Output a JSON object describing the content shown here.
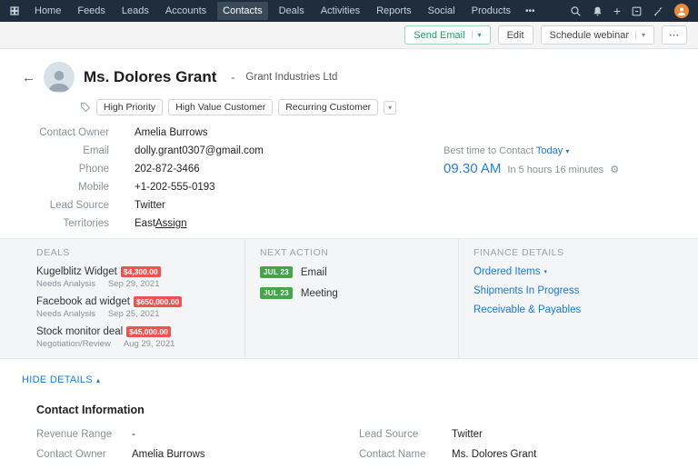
{
  "topnav": {
    "items": [
      "Home",
      "Feeds",
      "Leads",
      "Accounts",
      "Contacts",
      "Deals",
      "Activities",
      "Reports",
      "Social",
      "Products"
    ],
    "more": "•••"
  },
  "icons": {
    "plus": "+",
    "more": "•••",
    "ellipsis": "⋯",
    "caret_down": "▾",
    "caret_up": "▴",
    "back_arrow": "←",
    "gear": "⚙"
  },
  "actionbar": {
    "send_email": "Send Email",
    "edit": "Edit",
    "schedule_webinar": "Schedule webinar"
  },
  "contact": {
    "name": "Ms. Dolores Grant",
    "separator": "-",
    "company": "Grant Industries Ltd",
    "tags": [
      "High Priority",
      "High Value Customer",
      "Recurring Customer"
    ],
    "fields": [
      {
        "label": "Contact Owner",
        "value": "Amelia Burrows"
      },
      {
        "label": "Email",
        "value": "dolly.grant0307@gmail.com"
      },
      {
        "label": "Phone",
        "value": "202-872-3466"
      },
      {
        "label": "Mobile",
        "value": "+1-202-555-0193"
      },
      {
        "label": "Lead Source",
        "value": "Twitter"
      },
      {
        "label": "Territories",
        "value": "East"
      }
    ],
    "assign_label": "Assign",
    "best_time": {
      "label": "Best time to Contact",
      "day": "Today",
      "time": "09.30 AM",
      "note": "In 5 hours 16 minutes"
    }
  },
  "deals": {
    "title": "DEALS",
    "items": [
      {
        "name": "Kugelblitz Widget",
        "amount": "$4,300.00",
        "stage": "Needs Analysis",
        "date": "Sep 29, 2021"
      },
      {
        "name": "Facebook ad widget",
        "amount": "$650,000.00",
        "stage": "Needs Analysis",
        "date": "Sep 25, 2021"
      },
      {
        "name": "Stock monitor deal",
        "amount": "$45,000.00",
        "stage": "Negotiation/Review",
        "date": "Aug 29, 2021"
      }
    ]
  },
  "next_action": {
    "title": "NEXT ACTION",
    "items": [
      {
        "date": "JUL 23",
        "label": "Email"
      },
      {
        "date": "JUL 23",
        "label": "Meeting"
      }
    ]
  },
  "finance": {
    "title": "FINANCE DETAILS",
    "links": [
      "Ordered Items",
      "Shipments In Progress",
      "Receivable & Payables"
    ]
  },
  "details": {
    "hide_label": "HIDE DETAILS",
    "section_title": "Contact Information",
    "left": [
      {
        "label": "Revenue Range",
        "value": "-"
      },
      {
        "label": "Contact Owner",
        "value": "Amelia Burrows"
      }
    ],
    "right": [
      {
        "label": "Lead Source",
        "value": "Twitter"
      },
      {
        "label": "Contact Name",
        "value": "Ms. Dolores Grant"
      }
    ]
  },
  "colors": {
    "topbar_bg": "#1f2d3d",
    "accent_green": "#1e9e63",
    "link_blue": "#1a79d8",
    "time_blue": "#2b7cd8",
    "badge_red": "#ef5350",
    "badge_green": "#47a44c",
    "section_bg": "#f3f5f6"
  }
}
